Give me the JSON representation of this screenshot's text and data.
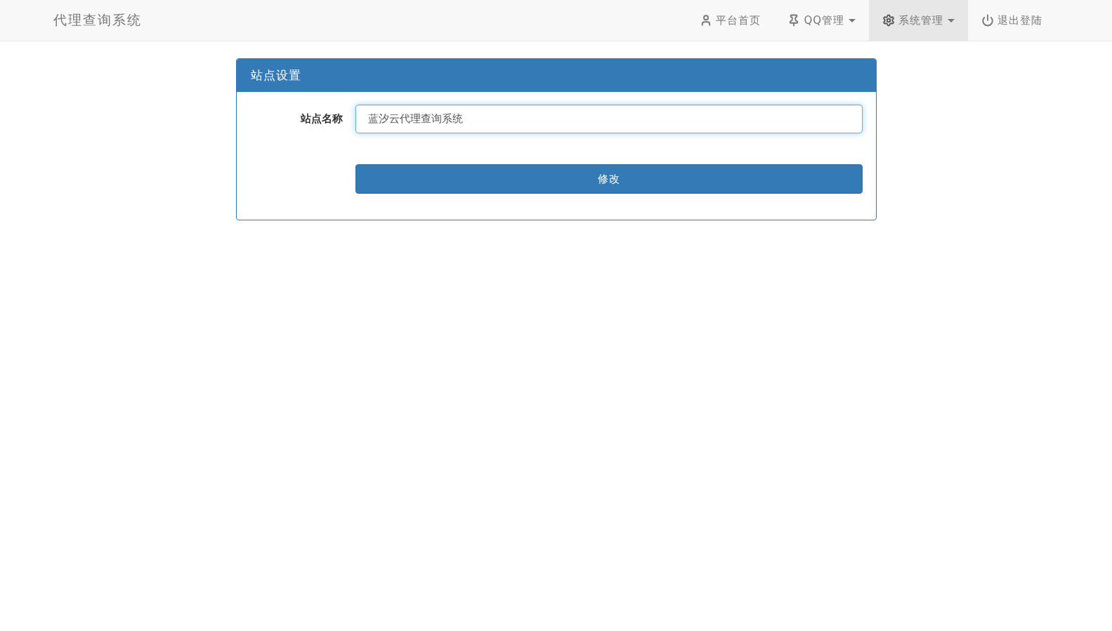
{
  "navbar": {
    "brand": "代理查询系统",
    "items": [
      {
        "kind": "user",
        "label": "平台首页",
        "dropdown": false,
        "selected": false
      },
      {
        "kind": "pin",
        "label": "QQ管理",
        "dropdown": true,
        "selected": false
      },
      {
        "kind": "gear",
        "label": "系统管理",
        "dropdown": true,
        "selected": true
      },
      {
        "kind": "power",
        "label": "退出登陆",
        "dropdown": false,
        "selected": false
      }
    ]
  },
  "panel": {
    "title": "站点设置",
    "fields": [
      {
        "label": "站点名称",
        "value": "蓝汐云代理查询系统"
      }
    ],
    "button": "修改"
  }
}
